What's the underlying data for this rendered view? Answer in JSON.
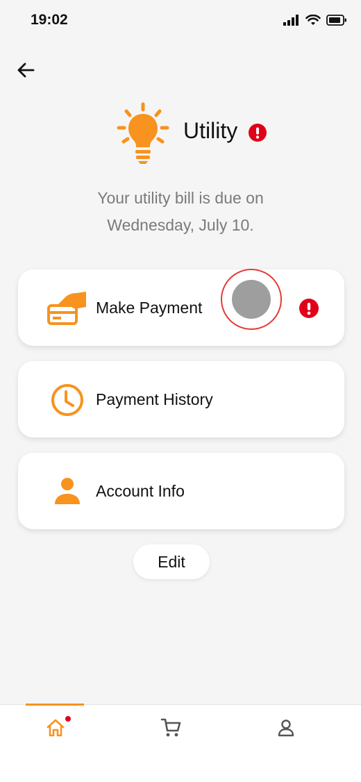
{
  "status_bar": {
    "time": "19:02",
    "icons": [
      "signal-icon",
      "wifi-icon",
      "battery-icon"
    ]
  },
  "header": {
    "back_icon": "arrow-left-icon",
    "icon": "lightbulb-icon",
    "title": "Utility",
    "alert_icon": "alert-icon"
  },
  "subtitle": {
    "line1": "Your utility bill is due on",
    "line2": "Wednesday, July 10."
  },
  "menu": [
    {
      "label": "Make Payment",
      "icon": "card-payment-icon",
      "has_alert": true
    },
    {
      "label": "Payment History",
      "icon": "clock-icon",
      "has_alert": false
    },
    {
      "label": "Account Info",
      "icon": "person-icon",
      "has_alert": false
    }
  ],
  "edit_label": "Edit",
  "tabbar": {
    "active": "home",
    "tabs": [
      {
        "name": "home",
        "icon": "home-icon",
        "has_dot": true
      },
      {
        "name": "cart",
        "icon": "cart-icon",
        "has_dot": false
      },
      {
        "name": "profile",
        "icon": "profile-icon",
        "has_dot": false
      }
    ]
  },
  "colors": {
    "accent": "#f7931e",
    "alert": "#e0001a",
    "background": "#f5f5f5",
    "subtitle_text": "#7a7a7a"
  }
}
